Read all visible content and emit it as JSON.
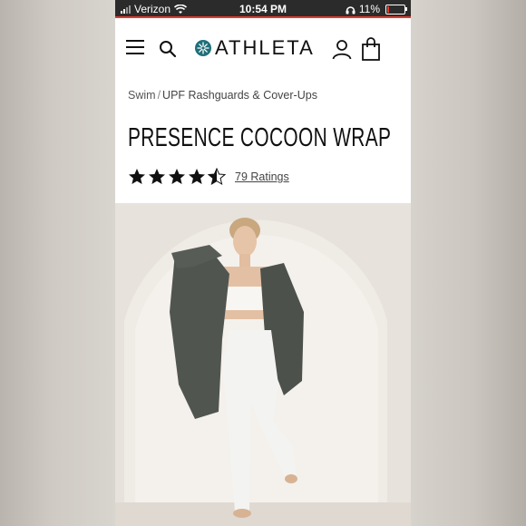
{
  "status_bar": {
    "carrier": "Verizon",
    "time": "10:54 PM",
    "battery": "11%"
  },
  "header": {
    "brand": "ATHLETA",
    "icons": [
      "menu-icon",
      "search-icon",
      "account-icon",
      "bag-icon"
    ]
  },
  "breadcrumb": {
    "parent": "Swim",
    "separator": "/",
    "current": "UPF Rashguards & Cover-Ups"
  },
  "product": {
    "title": "PRESENCE COCOON WRAP",
    "rating_value": 4.5,
    "ratings_label": "79 Ratings"
  },
  "colors": {
    "status_bar_bg": "#2b2b2b",
    "status_accent": "#e23a2c",
    "logo_teal": "#1f6f7a",
    "text_dark": "#111111"
  }
}
